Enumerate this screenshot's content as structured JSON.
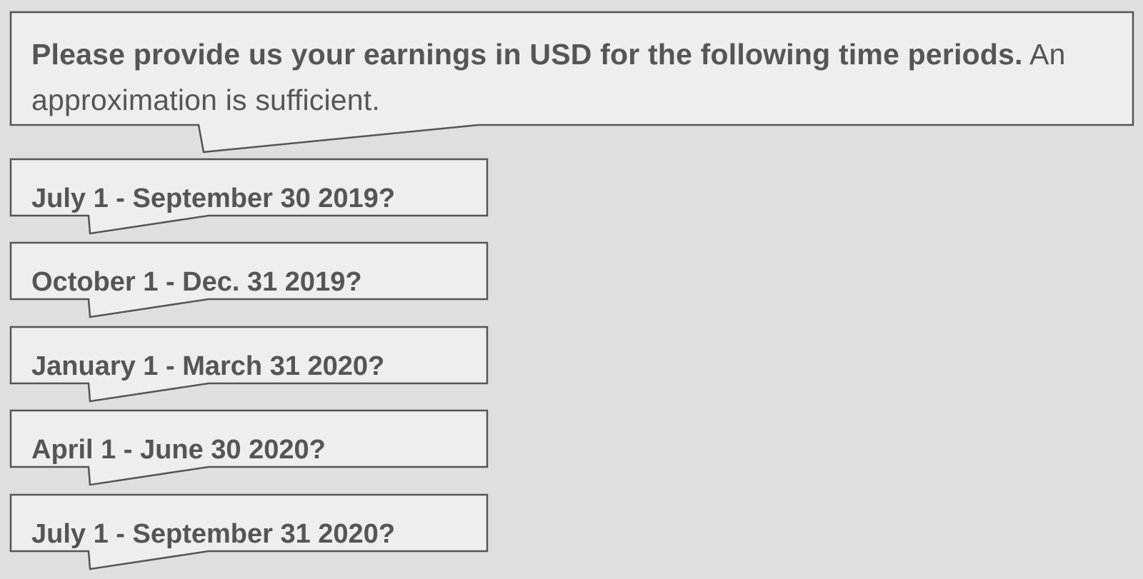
{
  "prompt": {
    "bold_text": "Please provide us your earnings in USD for the following time periods.",
    "regular_text": " An approximation is sufficient."
  },
  "periods": [
    {
      "label": "July 1 - September 30 2019?"
    },
    {
      "label": "October 1 - Dec. 31 2019?"
    },
    {
      "label": "January 1 - March 31 2020?"
    },
    {
      "label": "April 1 - June 30 2020?"
    },
    {
      "label": "July 1 - September 31 2020?"
    }
  ],
  "colors": {
    "background": "#dfdfdf",
    "bubble_fill": "#eeeeee",
    "border_and_text": "#555555"
  }
}
